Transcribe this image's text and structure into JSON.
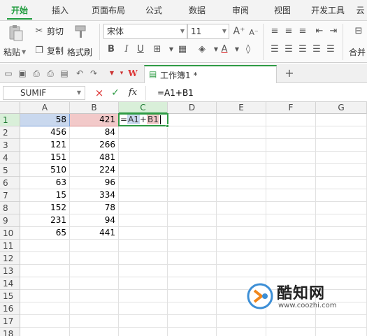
{
  "tabs": [
    "开始",
    "插入",
    "页面布局",
    "公式",
    "数据",
    "审阅",
    "视图",
    "开发工具",
    "云"
  ],
  "ribbon": {
    "paste_label": "粘贴",
    "cut_label": "剪切",
    "copy_label": "复制",
    "format_painter_label": "格式刷",
    "font_name": "宋体",
    "font_size": "11",
    "bold": "B",
    "italic": "I",
    "underline": "U",
    "merge_label": "合并"
  },
  "document": {
    "tab_title": "工作簿1 *"
  },
  "formula_bar": {
    "name_box": "SUMIF",
    "cancel": "×",
    "enter": "✓",
    "fx": "fx",
    "formula": "=A1+B1"
  },
  "columns": [
    "A",
    "B",
    "C",
    "D",
    "E",
    "F",
    "G"
  ],
  "rows": [
    "1",
    "2",
    "3",
    "4",
    "5",
    "6",
    "7",
    "8",
    "9",
    "10",
    "11",
    "12",
    "13",
    "14",
    "15",
    "16",
    "17",
    "18"
  ],
  "col_a": [
    "58",
    "456",
    "121",
    "151",
    "510",
    "63",
    "15",
    "152",
    "231",
    "65"
  ],
  "col_b": [
    "421",
    "84",
    "266",
    "481",
    "224",
    "96",
    "334",
    "78",
    "94",
    "441"
  ],
  "editing_cell": {
    "prefix": "=",
    "ref1": "A1",
    "op": "+",
    "ref2": "B1"
  },
  "watermark": {
    "name": "酷知网",
    "url": "www.coozhi.com"
  },
  "colors": {
    "accent": "#2e9b44",
    "ref_a_highlight": "#c9d8ee",
    "ref_b_highlight": "#f2c9c9"
  }
}
